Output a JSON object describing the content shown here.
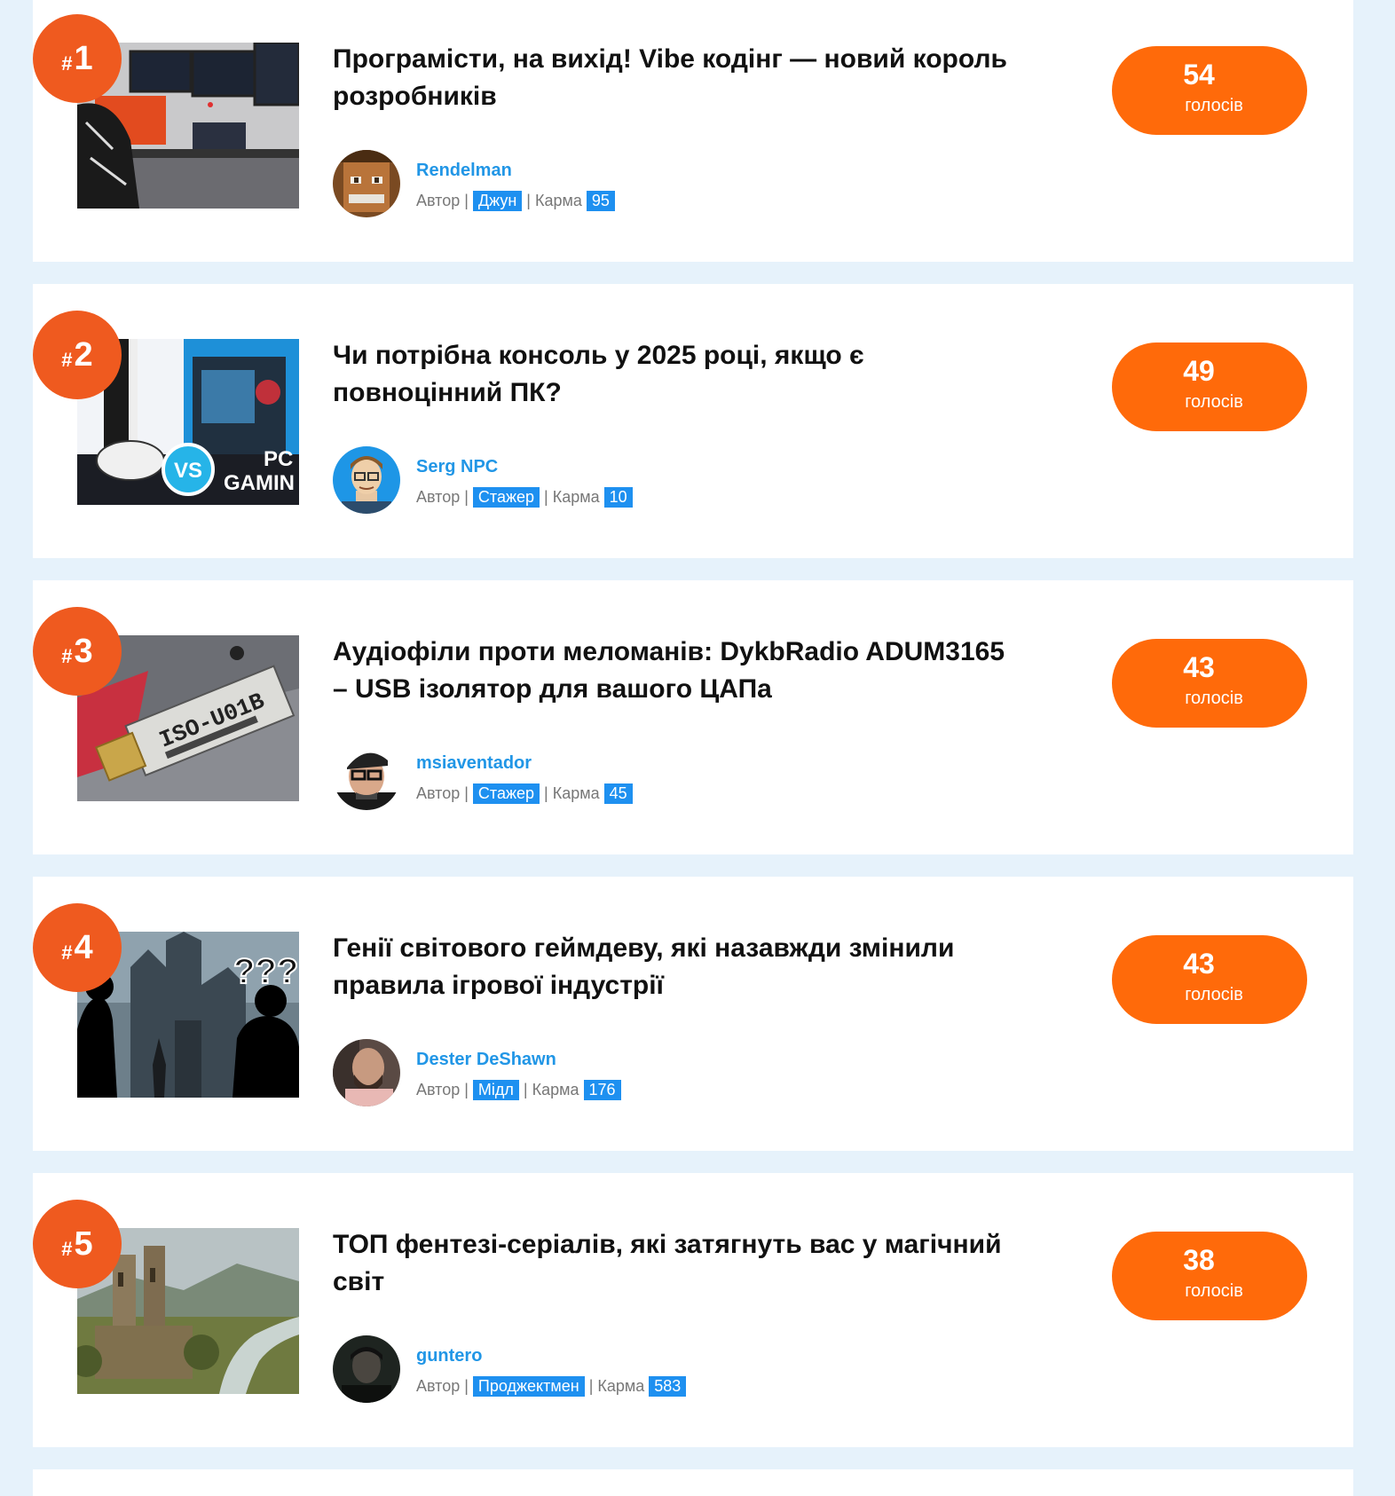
{
  "posts": [
    {
      "rank_prefix": "#",
      "rank": "1",
      "title": "Програмісти, на вихід! Vibe кодінг — новий король розробників",
      "author": "Rendelman",
      "author_role": "Автор |",
      "level": "Джун",
      "karma_label": "| Карма",
      "karma": "95",
      "votes": "54",
      "votes_label": "голосів",
      "thumbnail_icon": "desk-setup-image",
      "avatar_icon": "pixel-face-avatar"
    },
    {
      "rank_prefix": "#",
      "rank": "2",
      "title": "Чи потрібна консоль у 2025 році, якщо є повноцінний ПК?",
      "author": "Serg NPC",
      "author_role": "Автор |",
      "level": "Стажер",
      "karma_label": "| Карма",
      "karma": "10",
      "votes": "49",
      "votes_label": "голосів",
      "thumbnail_icon": "console-vs-pc-image",
      "thumbnail_text": [
        "VS",
        "PC",
        "GAMIN"
      ],
      "avatar_icon": "cartoon-man-avatar"
    },
    {
      "rank_prefix": "#",
      "rank": "3",
      "title": "Аудіофіли проти меломанів: DykbRadio ADUM3165 – USB ізолятор для вашого ЦАПа",
      "author": "msiaventador",
      "author_role": "Автор |",
      "level": "Стажер",
      "karma_label": "| Карма",
      "karma": "45",
      "votes": "43",
      "votes_label": "голосів",
      "thumbnail_icon": "usb-isolator-image",
      "thumbnail_text": [
        "ISO-U01B"
      ],
      "avatar_icon": "man-with-glasses-avatar"
    },
    {
      "rank_prefix": "#",
      "rank": "4",
      "title": "Генії світового геймдеву, які назавжди змінили правила ігрової індустрії",
      "author": "Dester DeShawn",
      "author_role": "Автор |",
      "level": "Мідл",
      "karma_label": "| Карма",
      "karma": "176",
      "votes": "43",
      "votes_label": "голосів",
      "thumbnail_icon": "dark-castle-silhouettes-image",
      "thumbnail_text": [
        "???"
      ],
      "avatar_icon": "bald-man-avatar"
    },
    {
      "rank_prefix": "#",
      "rank": "5",
      "title": "ТОП фентезі-серіалів, які затягнуть вас у магічний світ",
      "author": "guntero",
      "author_role": "Автор |",
      "level": "Проджектмен",
      "karma_label": "| Карма",
      "karma": "583",
      "votes": "38",
      "votes_label": "голосів",
      "thumbnail_icon": "fantasy-ruins-image",
      "avatar_icon": "dark-portrait-avatar"
    }
  ],
  "colors": {
    "page_bg": "#e6f2fb",
    "rank_circle": "#ef5a1f",
    "votes_pill": "#ff6a0a",
    "author_link": "#2196e6",
    "badge": "#1e90f0"
  }
}
